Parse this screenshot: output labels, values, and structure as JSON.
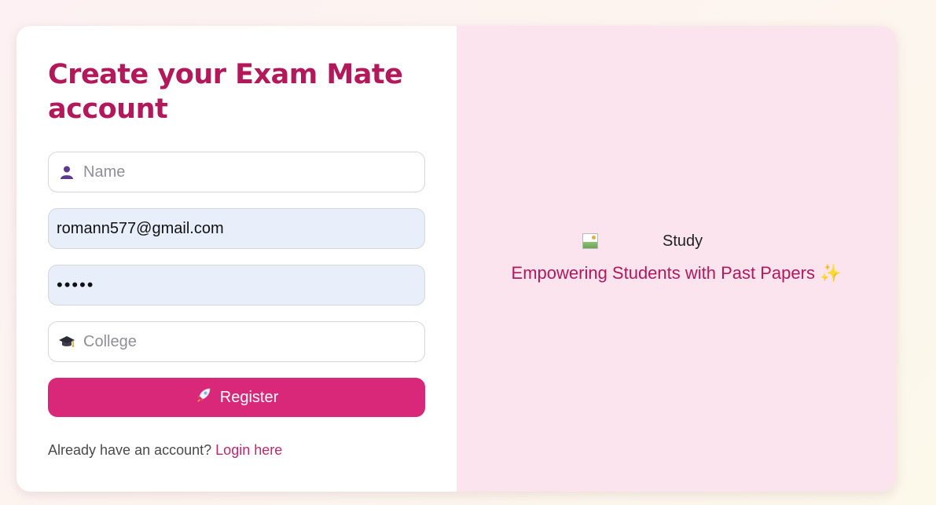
{
  "form": {
    "title": "Create your Exam Mate account",
    "name_placeholder": "Name",
    "name_icon": "user-icon",
    "email_value": "romann577@gmail.com",
    "password_value": "•••••",
    "college_placeholder": "College",
    "college_icon": "graduation-cap-icon",
    "register_label": "Register",
    "register_icon": "rocket-icon",
    "login_prompt": "Already have an account?",
    "login_link": "Login here"
  },
  "hero": {
    "image_alt": "Study",
    "tagline": "Empowering Students with Past Papers ✨"
  },
  "colors": {
    "accent": "#d9277a",
    "title": "#b3185b",
    "right_panel": "#fce4ef",
    "autofill": "#e8effb"
  }
}
